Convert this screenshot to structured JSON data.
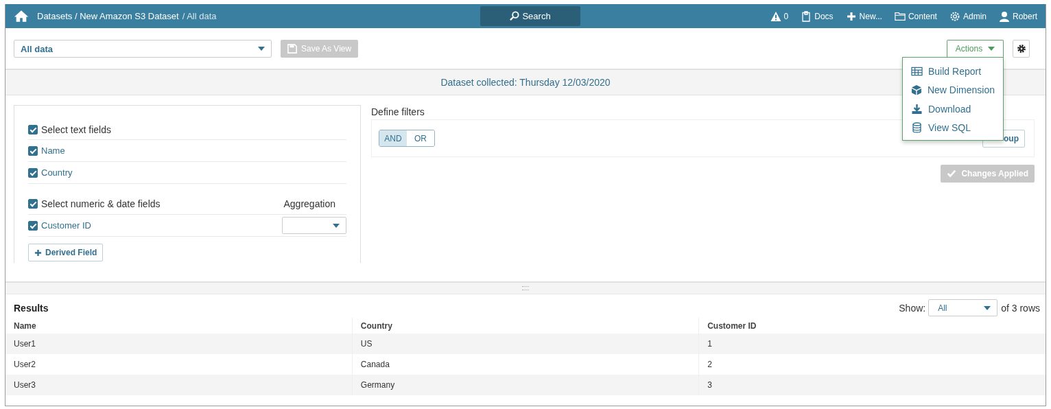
{
  "navbar": {
    "breadcrumb": [
      {
        "label": "Datasets / New Amazon S3 Dataset",
        "current": false
      },
      {
        "label": "/ All data",
        "current": true
      }
    ],
    "search": "Search",
    "items": [
      {
        "kind": "alert",
        "label": "0"
      },
      {
        "kind": "docs",
        "label": "Docs"
      },
      {
        "kind": "new",
        "label": "New..."
      },
      {
        "kind": "content",
        "label": "Content"
      },
      {
        "kind": "admin",
        "label": "Admin"
      },
      {
        "kind": "user",
        "label": "Robert"
      }
    ]
  },
  "toolbar": {
    "view_select": "All data",
    "save_button": {
      "label": "Save As View",
      "disabled": true
    },
    "actions_button": "Actions",
    "actions_expanded": true,
    "actions_menu": [
      {
        "kind": "report",
        "label": "Build Report"
      },
      {
        "kind": "dimension",
        "label": "New Dimension"
      },
      {
        "kind": "download",
        "label": "Download"
      },
      {
        "kind": "sql",
        "label": "View SQL"
      }
    ]
  },
  "banner": "Dataset collected: Thursday 12/03/2020",
  "fields": {
    "text_group": {
      "label": "Select text fields",
      "checked": true,
      "fields": [
        {
          "label": "Name",
          "checked": true
        },
        {
          "label": "Country",
          "checked": true
        }
      ]
    },
    "numeric_group": {
      "label": "Select numeric & date fields",
      "checked": true,
      "aggregation_label": "Aggregation",
      "fields": [
        {
          "label": "Customer ID",
          "checked": true
        }
      ]
    },
    "derived_button": "Derived Field"
  },
  "filters": {
    "title": "Define filters",
    "logic": [
      {
        "label": "AND",
        "selected": true
      },
      {
        "label": "OR",
        "selected": false
      }
    ],
    "group_button": "oup",
    "changes_button": {
      "label": "Changes Applied",
      "disabled": true
    }
  },
  "results": {
    "title": "Results",
    "show_label": "Show:",
    "show_value": "All",
    "rows_count": "of 3 rows",
    "columns": [
      "Name",
      "Country",
      "Customer ID"
    ],
    "rows": [
      [
        "User1",
        "US",
        "1"
      ],
      [
        "User2",
        "Canada",
        "2"
      ],
      [
        "User3",
        "Germany",
        "3"
      ]
    ]
  }
}
